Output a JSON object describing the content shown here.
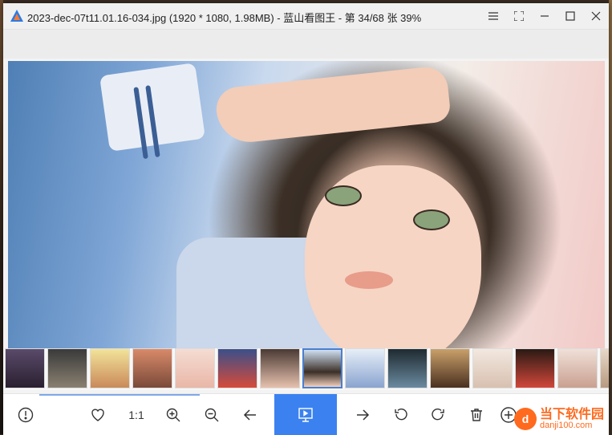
{
  "window": {
    "title": "2023-dec-07t11.01.16-034.jpg (1920 * 1080, 1.98MB) - 蓝山看图王 - 第 34/68 张 39%"
  },
  "title_controls": [
    {
      "name": "menu-icon",
      "glyph": "☰"
    },
    {
      "name": "fullscreen-icon",
      "glyph": "⛶"
    },
    {
      "name": "minimize-icon",
      "glyph": "—"
    },
    {
      "name": "maximize-icon",
      "glyph": "☐"
    },
    {
      "name": "close-icon",
      "glyph": "✕"
    }
  ],
  "bottombar": {
    "actual_size_label": "1:1"
  },
  "watermark": {
    "brand": "当下软件园",
    "site": "danji100.com"
  },
  "colors": {
    "accent": "#3b82f0",
    "watermark": "#ff6a1e"
  }
}
